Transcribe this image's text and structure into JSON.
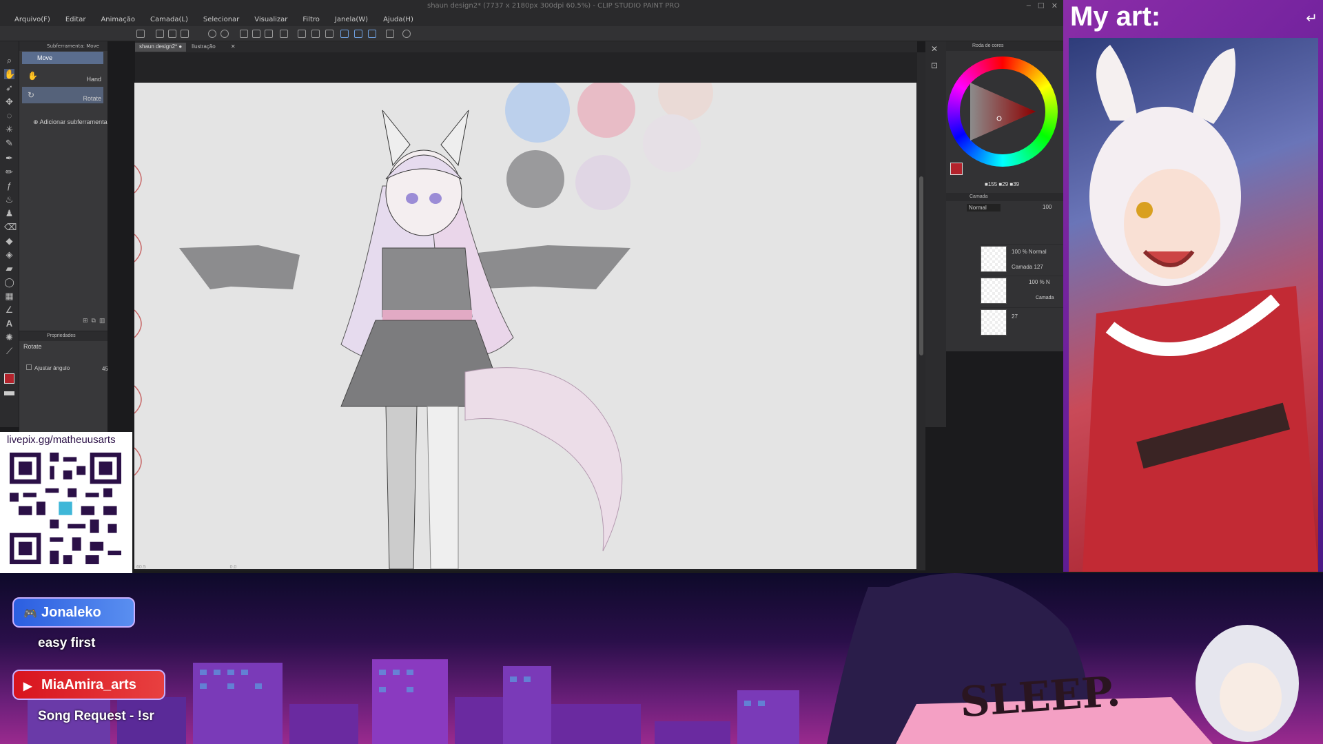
{
  "window": {
    "title": "shaun design2* (7737 x 2180px 300dpi 60.5%) - CLIP STUDIO PAINT PRO"
  },
  "menu": [
    "Arquivo(F)",
    "Editar",
    "Animação",
    "Camada(L)",
    "Selecionar",
    "Visualizar",
    "Filtro",
    "Janela(W)",
    "Ajuda(H)"
  ],
  "subtool": {
    "header": "Subferramenta: Move",
    "tab_label": "Move",
    "items": [
      {
        "label": "Hand"
      },
      {
        "label": "Rotate"
      }
    ],
    "add_label": "Adicionar subferramenta"
  },
  "properties": {
    "header": "Propriedades",
    "title": "Rotate",
    "checkbox_label": "Ajustar ângulo",
    "angle_value": "45"
  },
  "canvas": {
    "tabs": [
      "shaun design2*",
      "Ilustração"
    ],
    "zoom": "60.5",
    "angle": "0.0"
  },
  "color_panel": {
    "header": "Roda de cores",
    "r": "155",
    "g": "29",
    "b": "39"
  },
  "layers_panel": {
    "header": "Camada",
    "blend_mode": "Normal",
    "opacity": "100",
    "layers": [
      {
        "mode": "100 % Normal",
        "name": "Camada 127"
      },
      {
        "mode": "100 % N",
        "name": "Camada"
      },
      {
        "mode": "",
        "name": "27"
      }
    ]
  },
  "overlay": {
    "art_title": "My art:",
    "art_arrow": "↵",
    "donation_link": "livepix.gg/matheuusarts",
    "chat": [
      {
        "user": "Jonaleko",
        "message": "easy first",
        "color": "#3a6fe0"
      },
      {
        "user": "MiaAmira_arts",
        "message": "Song Request - !sr",
        "color": "#e0242e"
      }
    ],
    "shirt_text": "SLEEP."
  },
  "colors": {
    "accent": "#5a6d8e",
    "main_color": "#b3232c",
    "overlay_purple": "#8b2da8"
  }
}
